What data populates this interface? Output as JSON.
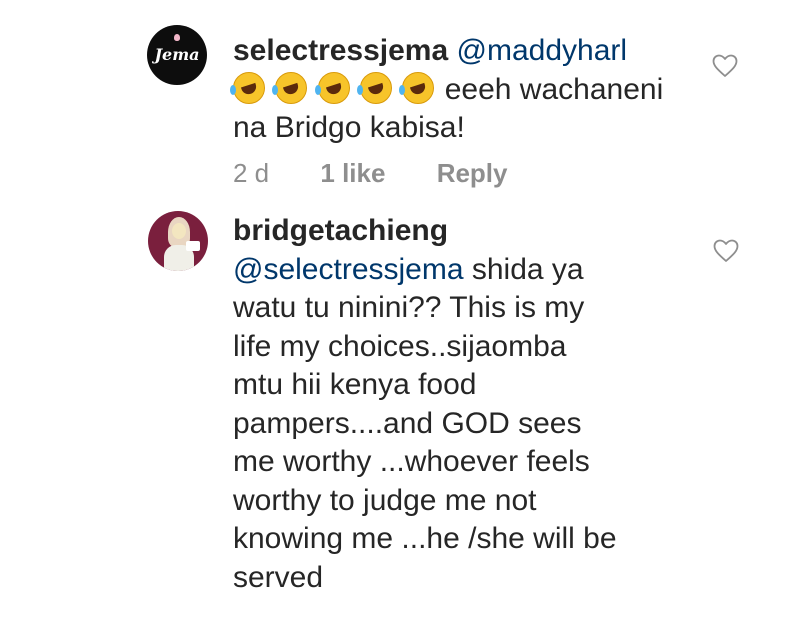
{
  "comments": [
    {
      "username": "selectressjema",
      "avatar_text": "Jema",
      "mention": "@maddyharl",
      "emoji_count": 5,
      "emoji_name": "rolling-on-floor-laughing-emoji",
      "lines": [
        "eeeh wachaneni",
        "na Bridgo kabisa!"
      ],
      "meta": {
        "time": "2 d",
        "likes": "1 like",
        "reply": "Reply"
      }
    },
    {
      "username": "bridgetachieng",
      "mention": "@selectressjema",
      "first_line_rest": "shida ya",
      "lines": [
        "watu tu ninini?? This is my",
        "life my choices..sijaomba",
        "mtu hii kenya food",
        "pampers....and GOD sees",
        "me worthy ...whoever feels",
        "worthy  to judge me not",
        "knowing  me ...he /she  will be",
        "served"
      ]
    }
  ],
  "icons": {
    "like": "heart-outline-icon"
  },
  "colors": {
    "text": "#262626",
    "mention": "#00376b",
    "meta": "#8e8e8e"
  }
}
